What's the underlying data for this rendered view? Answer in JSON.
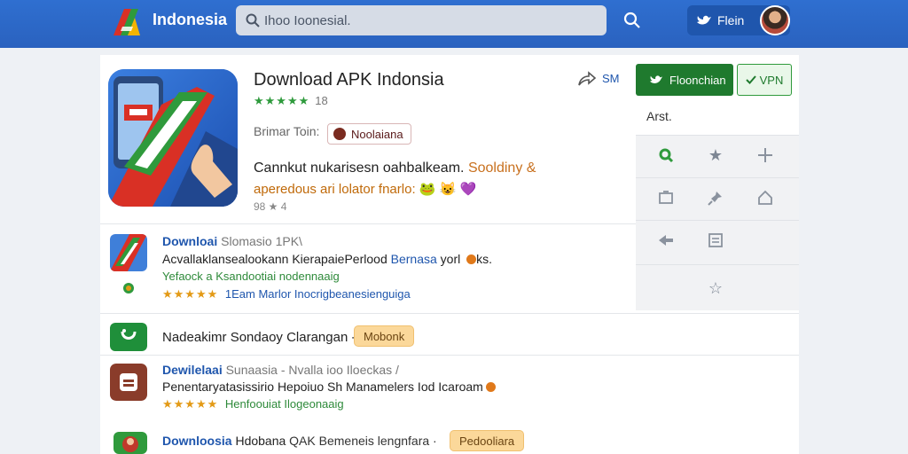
{
  "header": {
    "brand": "Indonesia",
    "search": {
      "value": "Ihoo Ioonesial.",
      "placeholder": ""
    },
    "signin_label": "Flein"
  },
  "app": {
    "title": "Download APK Indonsia",
    "stars": "★★★★★",
    "rating_count": "18",
    "developer_label": "Brimar Toin:",
    "developer_chip": "Noolaiana",
    "desc_line1": "Cannkut nukarisesn oahbalkeam.",
    "desc_line1_hl": "Sooldiny &",
    "desc_line2": "aperedous ari lolator fnarlo: 🐸 😺 💜",
    "meta": "98 ★ 4",
    "share_label": "SM"
  },
  "actions": {
    "download_label": "Floonchian",
    "vpn_label": "VPN",
    "side_title": "Arst.",
    "side_icons": [
      "search-icon",
      "star-icon",
      "plus-icon",
      "square-icon",
      "pin-icon",
      "home-icon",
      "arrow-left-icon",
      "edit-icon",
      "star-outline-icon"
    ]
  },
  "list": [
    {
      "title": "Downloai",
      "title_sub": "Slomasio 1PK\\",
      "line": "Acvallaklansealookann Kierapaie",
      "line_dark": "Perlood",
      "line_blue": "Bernasa",
      "line_end": "yorl",
      "line_tail": "ks.",
      "green": "Yefaock a Ksandootiai nodennaaig",
      "rate_stars": "★★★★★",
      "rate_text": "1Eam Marlor Inocrigbeanesienguiga",
      "colors": {
        "icon": "#3f7fd9"
      }
    },
    {
      "title": "Nadeakimr Sondaoy Clarangan -",
      "tag": "Mobonk",
      "colors": {
        "icon": "#1f8f3a"
      }
    },
    {
      "title": "Dewilelaai",
      "title_sub": "Sunaasia - Nvalla ioo Iloeckas /",
      "line": "Penentaryatasissirio Hepoiuo Sh Manamelers Iod Icaroam",
      "rate_stars": "★★★★★",
      "rate_text": "Henfoouiat Ilogeonaaig",
      "colors": {
        "icon": "#8a3c2a"
      }
    },
    {
      "title": "Downloosia",
      "title_dark": "Hdobana",
      "title_sub": "QAK Bemeneis lengnfara ·",
      "tag": "Pedooliara",
      "colors": {
        "icon": "#c0392b"
      }
    }
  ],
  "colors": {
    "primary": "#2f6fd0",
    "green": "#1f7a2e",
    "star": "#e39a16",
    "link": "#1f56ad"
  }
}
